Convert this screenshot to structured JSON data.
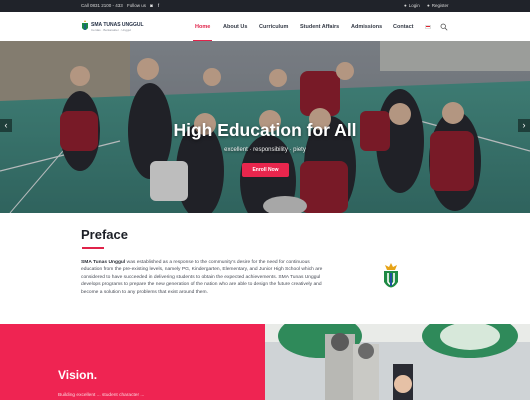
{
  "topbar": {
    "contact": "Call 0831 2100 - 433",
    "follow_label": "Follow us",
    "social_icons": [
      "instagram-icon",
      "facebook-icon"
    ],
    "login_label": "Login",
    "register_label": "Register"
  },
  "header": {
    "school_name": "SMA TUNAS UNGGUL",
    "tagline": "Cerdas · Berkarakter · Unggul"
  },
  "nav": {
    "items": [
      {
        "label": "Home",
        "active": true
      },
      {
        "label": "About Us",
        "active": false
      },
      {
        "label": "Curriculum",
        "active": false
      },
      {
        "label": "Student Affairs",
        "active": false
      },
      {
        "label": "Admissions",
        "active": false
      },
      {
        "label": "Contact",
        "active": false
      }
    ],
    "language_flag": "indonesia-flag-icon",
    "search_icon": "search-icon"
  },
  "hero": {
    "title": "High Education for All",
    "subtitle": "excellent · responsibility · piety",
    "cta_label": "Enroll Now",
    "prev_icon": "chevron-left-icon",
    "next_icon": "chevron-right-icon"
  },
  "preface": {
    "title": "Preface",
    "school_name": "SMA Tunas Unggul",
    "body": " was established as a response to the community's desire for the need for continuous education from the pre-existing levels, namely PG, Kindergarten, Elementary, and Junior High School which are considered to have succeeded in delivering students to obtain the expected achievements. SMA Tunas Unggul develops programs to prepare the new generation of the nation who are able to design the future creatively and become a solution to any problems that exist around them."
  },
  "vision": {
    "title": "Vision.",
    "text": "Building excellent ... student character ..."
  },
  "colors": {
    "accent": "#e0234a",
    "vision_bg": "#ef2452",
    "topbar_bg": "#20232a",
    "logo_green": "#1e8a44",
    "logo_blue": "#1f4fa0",
    "logo_gold": "#e6a317"
  }
}
